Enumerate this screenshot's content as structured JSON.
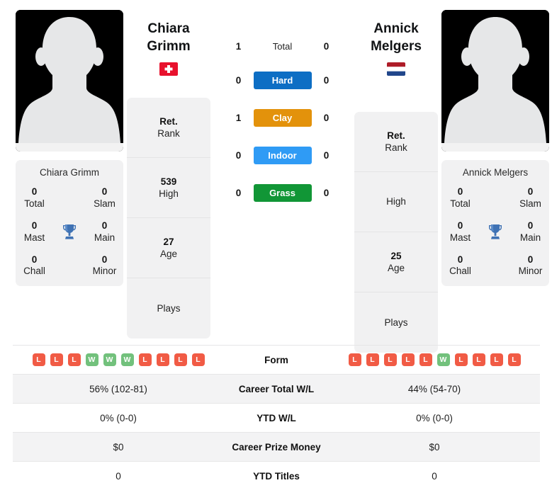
{
  "players": {
    "left": {
      "first_name": "Chiara",
      "last_name": "Grimm",
      "full_name": "Chiara Grimm",
      "flag": "switzerland-flag",
      "flag_alt": "Switzerland",
      "rank": "Ret.",
      "rank_label": "Rank",
      "high": "539",
      "high_label": "High",
      "age": "27",
      "age_label": "Age",
      "plays": "",
      "plays_label": "Plays",
      "titles": {
        "total": "0",
        "total_label": "Total",
        "slam": "0",
        "slam_label": "Slam",
        "mast": "0",
        "mast_label": "Mast",
        "main": "0",
        "main_label": "Main",
        "chall": "0",
        "chall_label": "Chall",
        "minor": "0",
        "minor_label": "Minor"
      },
      "form": [
        "L",
        "L",
        "L",
        "W",
        "W",
        "W",
        "L",
        "L",
        "L",
        "L"
      ],
      "career_wl": "56% (102-81)",
      "ytd_wl": "0% (0-0)",
      "career_prize": "$0",
      "ytd_titles": "0"
    },
    "right": {
      "first_name": "Annick",
      "last_name": "Melgers",
      "full_name": "Annick Melgers",
      "flag": "netherlands-flag",
      "flag_alt": "Netherlands",
      "rank": "Ret.",
      "rank_label": "Rank",
      "high": "",
      "high_label": "High",
      "age": "25",
      "age_label": "Age",
      "plays": "",
      "plays_label": "Plays",
      "titles": {
        "total": "0",
        "total_label": "Total",
        "slam": "0",
        "slam_label": "Slam",
        "mast": "0",
        "mast_label": "Mast",
        "main": "0",
        "main_label": "Main",
        "chall": "0",
        "chall_label": "Chall",
        "minor": "0",
        "minor_label": "Minor"
      },
      "form": [
        "L",
        "L",
        "L",
        "L",
        "L",
        "W",
        "L",
        "L",
        "L",
        "L"
      ],
      "career_wl": "44% (54-70)",
      "ytd_wl": "0% (0-0)",
      "career_prize": "$0",
      "ytd_titles": "0"
    }
  },
  "head_to_head": [
    {
      "label": "Total",
      "left": "1",
      "right": "0",
      "pill": false,
      "color": ""
    },
    {
      "label": "Hard",
      "left": "0",
      "right": "0",
      "pill": true,
      "color": "#0d6ec4"
    },
    {
      "label": "Clay",
      "left": "1",
      "right": "0",
      "pill": true,
      "color": "#e3920b"
    },
    {
      "label": "Indoor",
      "left": "0",
      "right": "0",
      "pill": true,
      "color": "#2f9bf5"
    },
    {
      "label": "Grass",
      "left": "0",
      "right": "0",
      "pill": true,
      "color": "#119636"
    }
  ],
  "table_rows": [
    {
      "label": "Form",
      "type": "form"
    },
    {
      "label": "Career Total W/L",
      "type": "text",
      "key": "career_wl"
    },
    {
      "label": "YTD W/L",
      "type": "text",
      "key": "ytd_wl"
    },
    {
      "label": "Career Prize Money",
      "type": "text",
      "key": "career_prize"
    },
    {
      "label": "YTD Titles",
      "type": "text",
      "key": "ytd_titles"
    }
  ],
  "colors": {
    "win": "#72c17c",
    "loss": "#f15b45",
    "card_bg": "#f1f1f2",
    "trophy": "#3f72b4"
  }
}
